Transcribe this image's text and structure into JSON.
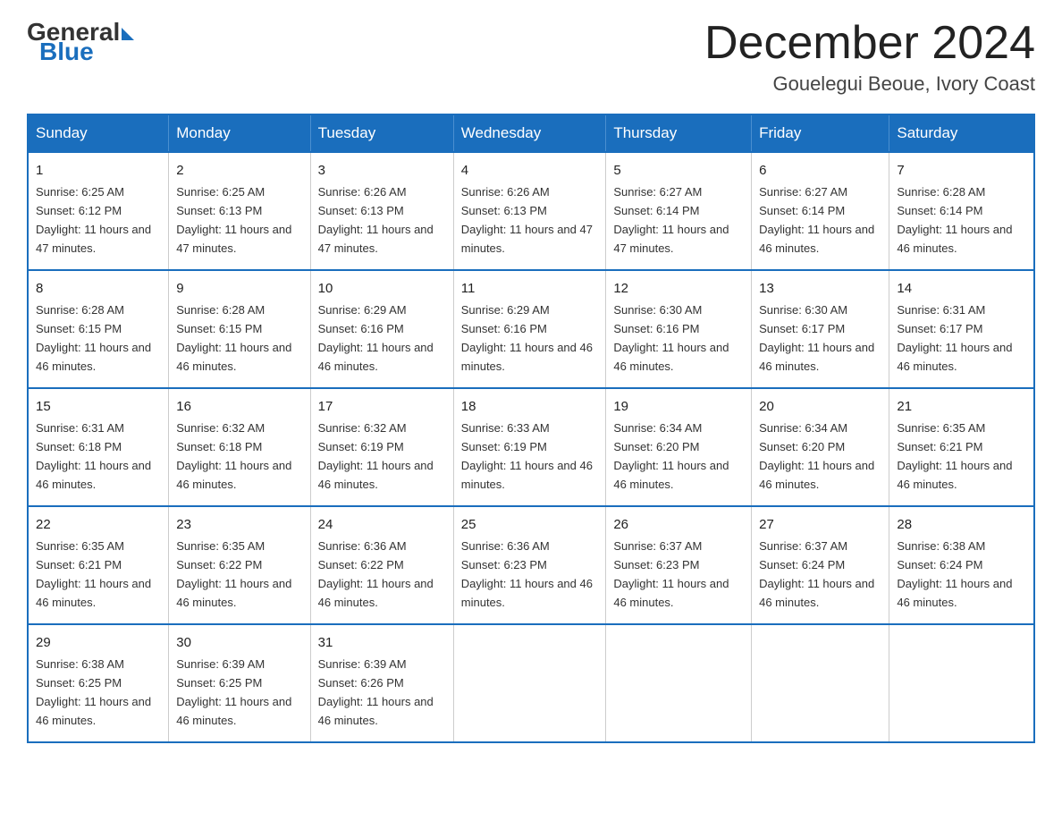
{
  "header": {
    "logo_general": "General",
    "logo_blue": "Blue",
    "title": "December 2024",
    "location": "Gouelegui Beoue, Ivory Coast"
  },
  "weekdays": [
    "Sunday",
    "Monday",
    "Tuesday",
    "Wednesday",
    "Thursday",
    "Friday",
    "Saturday"
  ],
  "weeks": [
    [
      {
        "day": "1",
        "sunrise": "6:25 AM",
        "sunset": "6:12 PM",
        "daylight": "11 hours and 47 minutes."
      },
      {
        "day": "2",
        "sunrise": "6:25 AM",
        "sunset": "6:13 PM",
        "daylight": "11 hours and 47 minutes."
      },
      {
        "day": "3",
        "sunrise": "6:26 AM",
        "sunset": "6:13 PM",
        "daylight": "11 hours and 47 minutes."
      },
      {
        "day": "4",
        "sunrise": "6:26 AM",
        "sunset": "6:13 PM",
        "daylight": "11 hours and 47 minutes."
      },
      {
        "day": "5",
        "sunrise": "6:27 AM",
        "sunset": "6:14 PM",
        "daylight": "11 hours and 47 minutes."
      },
      {
        "day": "6",
        "sunrise": "6:27 AM",
        "sunset": "6:14 PM",
        "daylight": "11 hours and 46 minutes."
      },
      {
        "day": "7",
        "sunrise": "6:28 AM",
        "sunset": "6:14 PM",
        "daylight": "11 hours and 46 minutes."
      }
    ],
    [
      {
        "day": "8",
        "sunrise": "6:28 AM",
        "sunset": "6:15 PM",
        "daylight": "11 hours and 46 minutes."
      },
      {
        "day": "9",
        "sunrise": "6:28 AM",
        "sunset": "6:15 PM",
        "daylight": "11 hours and 46 minutes."
      },
      {
        "day": "10",
        "sunrise": "6:29 AM",
        "sunset": "6:16 PM",
        "daylight": "11 hours and 46 minutes."
      },
      {
        "day": "11",
        "sunrise": "6:29 AM",
        "sunset": "6:16 PM",
        "daylight": "11 hours and 46 minutes."
      },
      {
        "day": "12",
        "sunrise": "6:30 AM",
        "sunset": "6:16 PM",
        "daylight": "11 hours and 46 minutes."
      },
      {
        "day": "13",
        "sunrise": "6:30 AM",
        "sunset": "6:17 PM",
        "daylight": "11 hours and 46 minutes."
      },
      {
        "day": "14",
        "sunrise": "6:31 AM",
        "sunset": "6:17 PM",
        "daylight": "11 hours and 46 minutes."
      }
    ],
    [
      {
        "day": "15",
        "sunrise": "6:31 AM",
        "sunset": "6:18 PM",
        "daylight": "11 hours and 46 minutes."
      },
      {
        "day": "16",
        "sunrise": "6:32 AM",
        "sunset": "6:18 PM",
        "daylight": "11 hours and 46 minutes."
      },
      {
        "day": "17",
        "sunrise": "6:32 AM",
        "sunset": "6:19 PM",
        "daylight": "11 hours and 46 minutes."
      },
      {
        "day": "18",
        "sunrise": "6:33 AM",
        "sunset": "6:19 PM",
        "daylight": "11 hours and 46 minutes."
      },
      {
        "day": "19",
        "sunrise": "6:34 AM",
        "sunset": "6:20 PM",
        "daylight": "11 hours and 46 minutes."
      },
      {
        "day": "20",
        "sunrise": "6:34 AM",
        "sunset": "6:20 PM",
        "daylight": "11 hours and 46 minutes."
      },
      {
        "day": "21",
        "sunrise": "6:35 AM",
        "sunset": "6:21 PM",
        "daylight": "11 hours and 46 minutes."
      }
    ],
    [
      {
        "day": "22",
        "sunrise": "6:35 AM",
        "sunset": "6:21 PM",
        "daylight": "11 hours and 46 minutes."
      },
      {
        "day": "23",
        "sunrise": "6:35 AM",
        "sunset": "6:22 PM",
        "daylight": "11 hours and 46 minutes."
      },
      {
        "day": "24",
        "sunrise": "6:36 AM",
        "sunset": "6:22 PM",
        "daylight": "11 hours and 46 minutes."
      },
      {
        "day": "25",
        "sunrise": "6:36 AM",
        "sunset": "6:23 PM",
        "daylight": "11 hours and 46 minutes."
      },
      {
        "day": "26",
        "sunrise": "6:37 AM",
        "sunset": "6:23 PM",
        "daylight": "11 hours and 46 minutes."
      },
      {
        "day": "27",
        "sunrise": "6:37 AM",
        "sunset": "6:24 PM",
        "daylight": "11 hours and 46 minutes."
      },
      {
        "day": "28",
        "sunrise": "6:38 AM",
        "sunset": "6:24 PM",
        "daylight": "11 hours and 46 minutes."
      }
    ],
    [
      {
        "day": "29",
        "sunrise": "6:38 AM",
        "sunset": "6:25 PM",
        "daylight": "11 hours and 46 minutes."
      },
      {
        "day": "30",
        "sunrise": "6:39 AM",
        "sunset": "6:25 PM",
        "daylight": "11 hours and 46 minutes."
      },
      {
        "day": "31",
        "sunrise": "6:39 AM",
        "sunset": "6:26 PM",
        "daylight": "11 hours and 46 minutes."
      },
      null,
      null,
      null,
      null
    ]
  ],
  "labels": {
    "sunrise_prefix": "Sunrise: ",
    "sunset_prefix": "Sunset: ",
    "daylight_prefix": "Daylight: "
  }
}
